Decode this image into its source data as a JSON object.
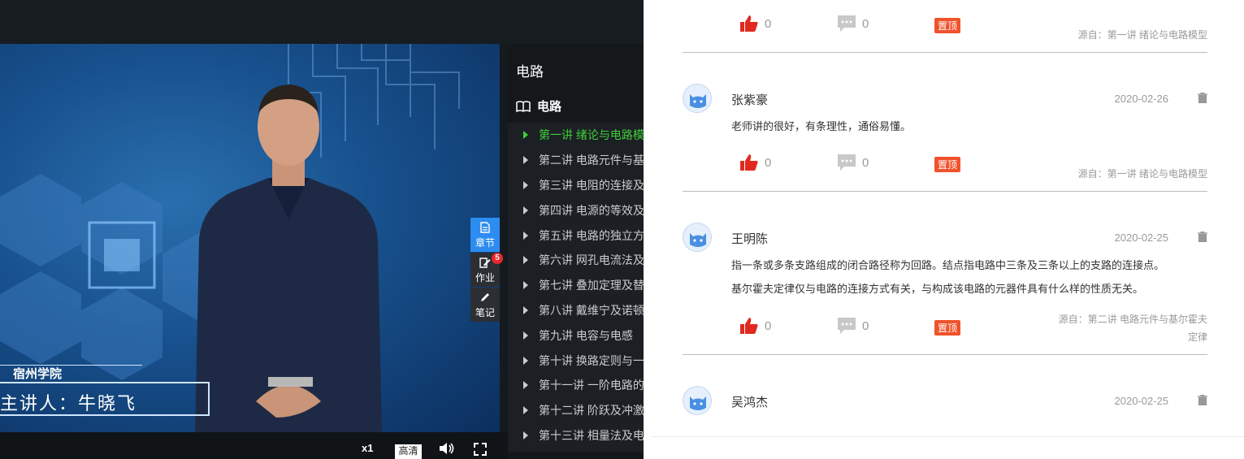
{
  "player": {
    "school": "宿州学院",
    "lecturer": "主讲人：牛晓飞",
    "speed": "x1",
    "quality": "高清"
  },
  "side_tabs": [
    {
      "label": "章节",
      "icon": "document-icon",
      "active": true
    },
    {
      "label": "作业",
      "icon": "edit-icon",
      "badge": "5"
    },
    {
      "label": "笔记",
      "icon": "pen-icon"
    }
  ],
  "chapters": {
    "header": "电路",
    "course": "电路",
    "items": [
      "第一讲 绪论与电路模型",
      "第二讲 电路元件与基尔霍夫定律",
      "第三讲 电阻的连接及等效变换",
      "第四讲 电源的等效及变换",
      "第五讲 电路的独立方程",
      "第六讲 网孔电流法及节点电压法",
      "第七讲 叠加定理及替代定理",
      "第八讲 戴维宁及诺顿定理",
      "第九讲 电容与电感",
      "第十讲 换路定则与一阶电路",
      "第十一讲 一阶电路的响应",
      "第十二讲 阶跃及冲激响应",
      "第十三讲 相量法及电路"
    ]
  },
  "comments": [
    {
      "likes": "0",
      "replies": "0",
      "pin": "置顶",
      "source": "源自：第一讲 绪论与电路模型"
    },
    {
      "user": "张紫豪",
      "date": "2020-02-26",
      "text": [
        "老师讲的很好，有条理性，通俗易懂。"
      ],
      "likes": "0",
      "replies": "0",
      "pin": "置顶",
      "source": "源自：第一讲 绪论与电路模型"
    },
    {
      "user": "王明陈",
      "date": "2020-02-25",
      "text": [
        "指一条或多条支路组成的闭合路径称为回路。结点指电路中三条及三条以上的支路的连接点。",
        "基尔霍夫定律仅与电路的连接方式有关，与构成该电路的元器件具有什么样的性质无关。"
      ],
      "likes": "0",
      "replies": "0",
      "pin": "置顶",
      "source": [
        "源自：第二讲 电路元件与基尔霍夫",
        "定律"
      ]
    },
    {
      "user": "吴鸿杰",
      "date": "2020-02-25"
    }
  ]
}
